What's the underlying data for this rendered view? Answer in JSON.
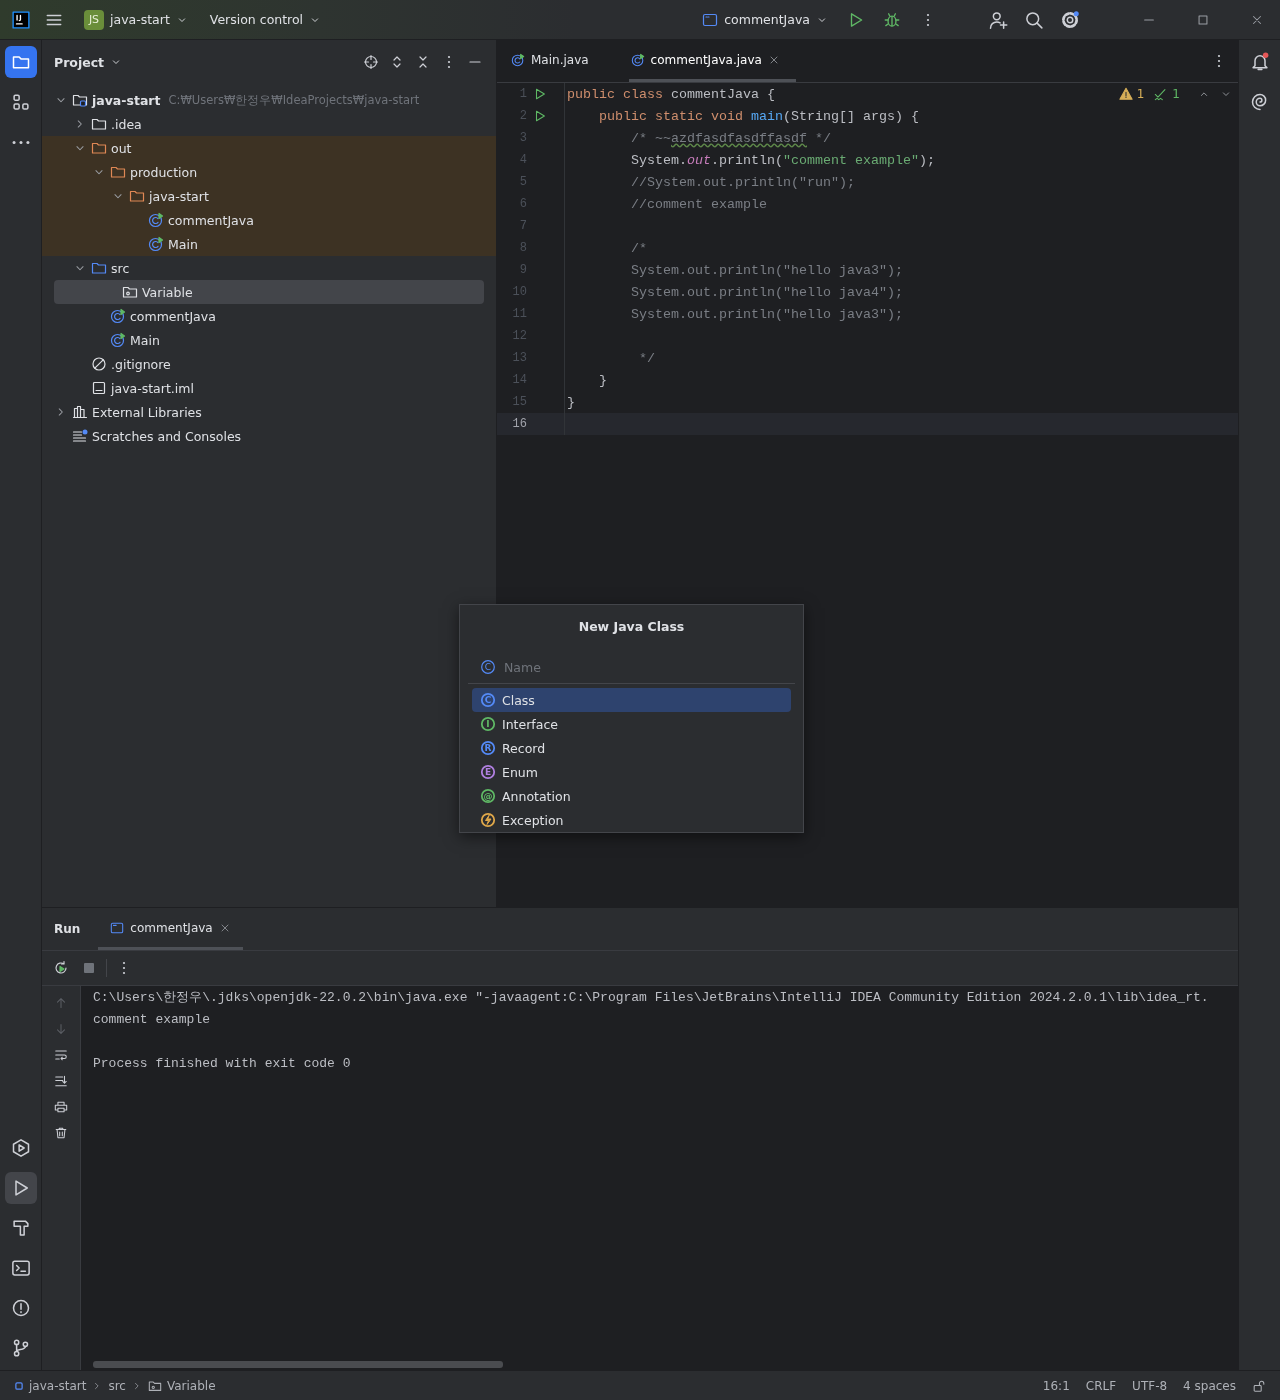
{
  "title_bar": {
    "project_badge": "JS",
    "project": "java-start",
    "vcs": "Version control",
    "run_config": "commentJava"
  },
  "left_toolbar": {
    "top": [
      {
        "kind": "project",
        "selected": true
      },
      {
        "kind": "structure",
        "selected": false
      },
      {
        "kind": "more",
        "selected": false
      }
    ],
    "bottom": [
      {
        "kind": "services",
        "selected": false
      },
      {
        "kind": "run",
        "selected": true
      },
      {
        "kind": "build",
        "selected": false
      },
      {
        "kind": "terminal",
        "selected": false
      },
      {
        "kind": "problems",
        "selected": false
      },
      {
        "kind": "git",
        "selected": false
      }
    ]
  },
  "right_toolbar": [
    {
      "kind": "notifications"
    },
    {
      "kind": "ai"
    }
  ],
  "project_panel": {
    "title": "Project",
    "tree": [
      {
        "label": "java-start",
        "path": "C:₩Users₩한정우₩IdeaProjects₩java-start",
        "kind": "module",
        "expanded": true,
        "selected": false,
        "excluded": false,
        "children": [
          {
            "label": ".idea",
            "kind": "folder",
            "expanded": false,
            "selected": false,
            "excluded": false
          },
          {
            "label": "out",
            "kind": "folder-excluded",
            "expanded": true,
            "selected": false,
            "excluded": true,
            "children": [
              {
                "label": "production",
                "kind": "folder-excluded",
                "expanded": true,
                "selected": false,
                "excluded": true,
                "children": [
                  {
                    "label": "java-start",
                    "kind": "folder-excluded",
                    "expanded": true,
                    "selected": false,
                    "excluded": true,
                    "children": [
                      {
                        "label": "commentJava",
                        "kind": "class",
                        "selected": false,
                        "excluded": true
                      },
                      {
                        "label": "Main",
                        "kind": "class",
                        "selected": false,
                        "excluded": true
                      }
                    ]
                  }
                ]
              }
            ]
          },
          {
            "label": "src",
            "kind": "folder-source",
            "expanded": true,
            "selected": false,
            "excluded": false,
            "children": [
              {
                "label": "Variable",
                "kind": "package",
                "selected": true,
                "excluded": false
              },
              {
                "label": "commentJava",
                "kind": "class",
                "selected": false,
                "excluded": false
              },
              {
                "label": "Main",
                "kind": "class",
                "selected": false,
                "excluded": false
              }
            ]
          },
          {
            "label": ".gitignore",
            "kind": "ignore",
            "selected": false,
            "excluded": false
          },
          {
            "label": "java-start.iml",
            "kind": "iml",
            "selected": false,
            "excluded": false
          }
        ]
      },
      {
        "label": "External Libraries",
        "kind": "libraries",
        "expanded": false,
        "selected": false,
        "excluded": false
      },
      {
        "label": "Scratches and Consoles",
        "kind": "scratches",
        "selected": false,
        "excluded": false
      }
    ]
  },
  "editor": {
    "tabs": [
      {
        "label": "Main.java",
        "selected": false
      },
      {
        "label": "commentJava.java",
        "selected": true
      }
    ],
    "inspections": {
      "warnings": "1",
      "passed": "1"
    },
    "lines": [
      {
        "number": "1",
        "run": true,
        "current": false,
        "tokens": [
          {
            "text": "public class ",
            "kind": "keyword"
          },
          {
            "text": "commentJava {",
            "kind": "plain"
          }
        ]
      },
      {
        "number": "2",
        "run": true,
        "current": false,
        "tokens": [
          {
            "text": "    public static void ",
            "kind": "keyword"
          },
          {
            "text": "main",
            "kind": "function"
          },
          {
            "text": "(String[] args) {",
            "kind": "plain"
          }
        ]
      },
      {
        "number": "3",
        "run": false,
        "current": false,
        "tokens": [
          {
            "text": "        /* ~~",
            "kind": "comment"
          },
          {
            "text": "azdfasdfasdffasdf",
            "kind": "typo"
          },
          {
            "text": " */",
            "kind": "comment"
          }
        ]
      },
      {
        "number": "4",
        "run": false,
        "current": false,
        "tokens": [
          {
            "text": "        System.",
            "kind": "plain"
          },
          {
            "text": "out",
            "kind": "static"
          },
          {
            "text": ".println(",
            "kind": "plain"
          },
          {
            "text": "\"comment example\"",
            "kind": "string"
          },
          {
            "text": ");",
            "kind": "plain"
          }
        ]
      },
      {
        "number": "5",
        "run": false,
        "current": false,
        "tokens": [
          {
            "text": "        //System.out.println(\"run\");",
            "kind": "comment"
          }
        ]
      },
      {
        "number": "6",
        "run": false,
        "current": false,
        "tokens": [
          {
            "text": "        //comment example",
            "kind": "comment"
          }
        ]
      },
      {
        "number": "7",
        "run": false,
        "current": false
      },
      {
        "number": "8",
        "run": false,
        "current": false,
        "tokens": [
          {
            "text": "        /*",
            "kind": "comment"
          }
        ]
      },
      {
        "number": "9",
        "run": false,
        "current": false,
        "tokens": [
          {
            "text": "        System.out.println(\"hello java3\");",
            "kind": "comment"
          }
        ]
      },
      {
        "number": "10",
        "run": false,
        "current": false,
        "tokens": [
          {
            "text": "        System.out.println(\"hello java4\");",
            "kind": "comment"
          }
        ]
      },
      {
        "number": "11",
        "run": false,
        "current": false,
        "tokens": [
          {
            "text": "        System.out.println(\"hello java3\");",
            "kind": "comment"
          }
        ]
      },
      {
        "number": "12",
        "run": false,
        "current": false
      },
      {
        "number": "13",
        "run": false,
        "current": false,
        "tokens": [
          {
            "text": "         */",
            "kind": "comment"
          }
        ]
      },
      {
        "number": "14",
        "run": false,
        "current": false,
        "tokens": [
          {
            "text": "    }",
            "kind": "plain"
          }
        ]
      },
      {
        "number": "15",
        "run": false,
        "current": false,
        "tokens": [
          {
            "text": "}",
            "kind": "plain"
          }
        ]
      },
      {
        "number": "16",
        "run": false,
        "current": true
      }
    ]
  },
  "new_class_dialog": {
    "title": "New Java Class",
    "field_glyph": "C",
    "placeholder": "Name",
    "items": [
      {
        "label": "Class",
        "glyph": "C",
        "color": "#548af7",
        "selected": true
      },
      {
        "label": "Interface",
        "glyph": "I",
        "color": "#5fb865",
        "selected": false
      },
      {
        "label": "Record",
        "glyph": "R",
        "color": "#548af7",
        "selected": false
      },
      {
        "label": "Enum",
        "glyph": "E",
        "color": "#b07fe0",
        "selected": false
      },
      {
        "label": "Annotation",
        "glyph": "@",
        "color": "#5fb865",
        "selected": false
      },
      {
        "label": "Exception",
        "color": "#e0a84a",
        "selected": false
      }
    ]
  },
  "run_panel": {
    "title": "Run",
    "tabs": [
      {
        "label": "commentJava",
        "selected": true
      }
    ],
    "console": {
      "output": [
        "C:\\Users\\한정우\\.jdks\\openjdk-22.0.2\\bin\\java.exe \"-javaagent:C:\\Program Files\\JetBrains\\IntelliJ IDEA Community Edition 2024.2.0.1\\lib\\idea_rt.",
        "comment example"
      ],
      "exit_message": "Process finished with exit code 0"
    }
  },
  "status_bar": {
    "breadcrumbs": [
      {
        "label": "java-start",
        "kind": "module"
      },
      {
        "label": "src",
        "kind": "plain"
      },
      {
        "label": "Variable",
        "kind": "package"
      }
    ],
    "items": [
      "16:1",
      "CRLF",
      "UTF-8",
      "4 spaces"
    ]
  }
}
